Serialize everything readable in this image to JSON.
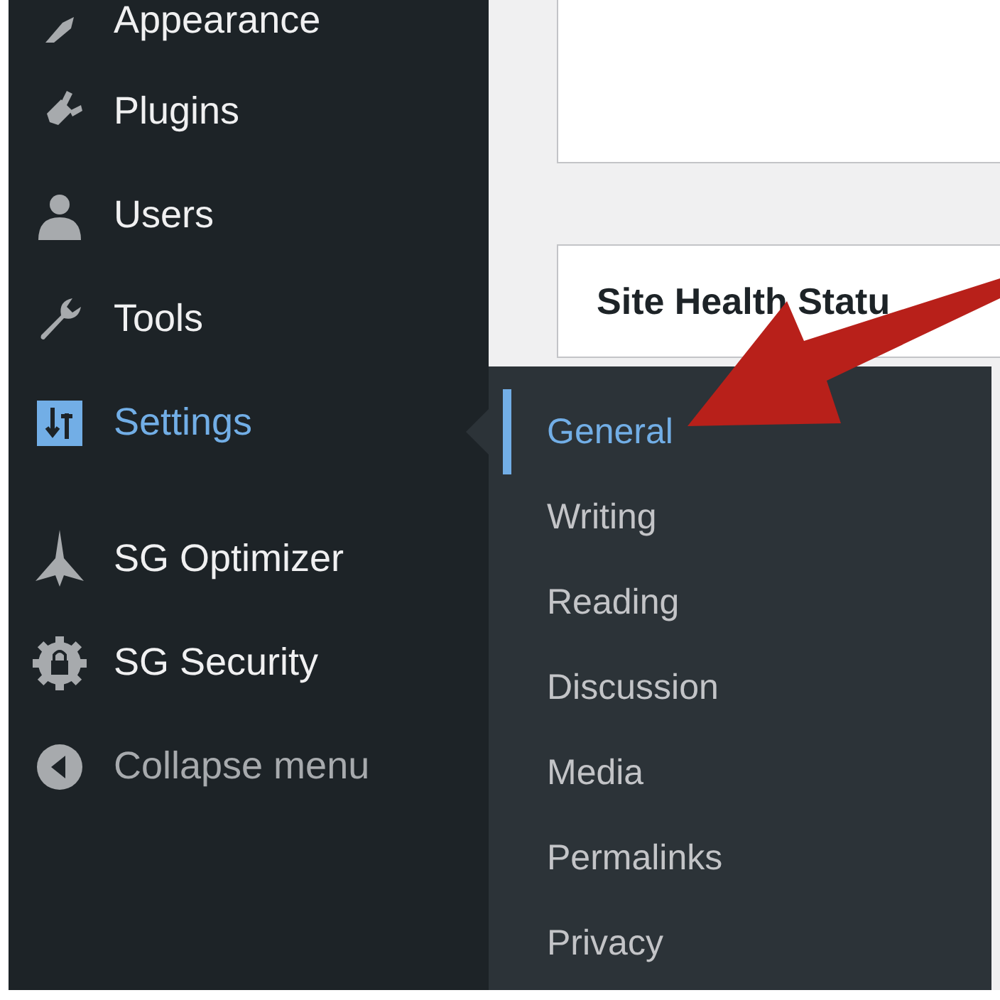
{
  "sidebar": {
    "items": [
      {
        "label": "Appearance",
        "kind": "menu",
        "selected": false
      },
      {
        "label": "Plugins",
        "kind": "menu",
        "selected": false
      },
      {
        "label": "Users",
        "kind": "menu",
        "selected": false
      },
      {
        "label": "Tools",
        "kind": "menu",
        "selected": false
      },
      {
        "label": "Settings",
        "kind": "menu",
        "selected": true
      },
      {
        "label": "SG Optimizer",
        "kind": "menu",
        "selected": false
      },
      {
        "label": "SG Security",
        "kind": "menu",
        "selected": false
      },
      {
        "label": "Collapse menu",
        "kind": "collapse",
        "selected": false
      }
    ]
  },
  "submenu": {
    "items": [
      {
        "label": "General",
        "selected": true
      },
      {
        "label": "Writing",
        "selected": false
      },
      {
        "label": "Reading",
        "selected": false
      },
      {
        "label": "Discussion",
        "selected": false
      },
      {
        "label": "Media",
        "selected": false
      },
      {
        "label": "Permalinks",
        "selected": false
      },
      {
        "label": "Privacy",
        "selected": false
      }
    ]
  },
  "main": {
    "card_title": "Site Health Statu"
  }
}
